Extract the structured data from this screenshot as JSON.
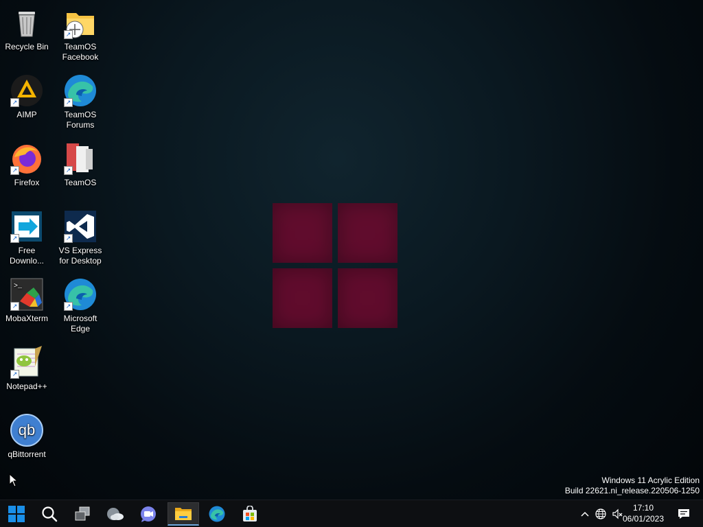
{
  "desktop": {
    "icons": [
      {
        "label": "Recycle Bin",
        "icon": "recycle-bin-icon",
        "shortcut": false
      },
      {
        "label": "TeamOS Facebook",
        "icon": "teamos-facebook-icon",
        "shortcut": true
      },
      {
        "label": "AIMP",
        "icon": "aimp-icon",
        "shortcut": true
      },
      {
        "label": "TeamOS Forums",
        "icon": "edge-icon",
        "shortcut": true
      },
      {
        "label": "Firefox",
        "icon": "firefox-icon",
        "shortcut": true
      },
      {
        "label": "TeamOS",
        "icon": "teamos-icon",
        "shortcut": true
      },
      {
        "label": "Free Downlo...",
        "icon": "free-download-manager-icon",
        "shortcut": true
      },
      {
        "label": "VS Express for Desktop",
        "icon": "visual-studio-icon",
        "shortcut": true
      },
      {
        "label": "MobaXterm",
        "icon": "mobaxterm-icon",
        "shortcut": true
      },
      {
        "label": "Microsoft Edge",
        "icon": "edge-icon",
        "shortcut": true
      },
      {
        "label": "Notepad++",
        "icon": "notepadpp-icon",
        "shortcut": true
      },
      {
        "label": "qBittorrent",
        "icon": "qbittorrent-icon",
        "shortcut": true
      }
    ]
  },
  "watermark": {
    "line1": "Windows 11 Acrylic Edition",
    "line2": "Build 22621.ni_release.220506-1250"
  },
  "taskbar": {
    "buttons": [
      "start-icon",
      "search-icon",
      "task-view-icon",
      "widgets-icon",
      "teams-chat-icon",
      "file-explorer-icon",
      "edge-icon",
      "store-icon"
    ],
    "active_button": "file-explorer-icon"
  },
  "tray": {
    "icons": [
      "chevron-up-icon",
      "network-icon",
      "volume-muted-icon"
    ],
    "time": "17:10",
    "date": "06/01/2023",
    "notification_icon": "notification-icon"
  },
  "colors": {
    "logo": "#6a0b2e",
    "taskbar": "#0d0f12",
    "accent": "#6ea8de"
  }
}
